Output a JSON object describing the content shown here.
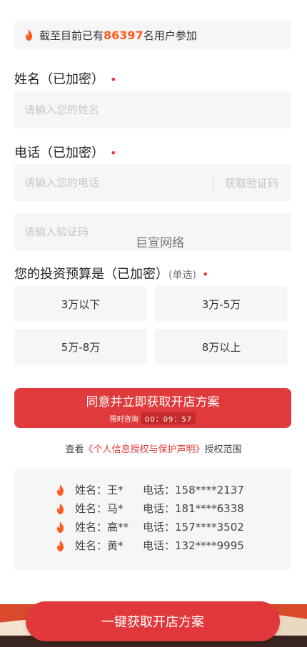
{
  "banner": {
    "prefix": "截至目前已有",
    "count": "86397",
    "suffix": "名用户参加"
  },
  "form": {
    "name_label": "姓名（已加密）",
    "name_placeholder": "请输入您的姓名",
    "phone_label": "电话（已加密）",
    "phone_placeholder": "请输入您的电话",
    "get_code": "获取验证码",
    "code_placeholder": "请输入验证码",
    "required_mark": "•",
    "budget_label": "您的投资预算是（已加密）",
    "budget_sub": "(单选)",
    "budget_options": [
      "3万以下",
      "3万-5万",
      "5万-8万",
      "8万以上"
    ]
  },
  "watermark": "巨宣网络",
  "submit": {
    "label": "同意并立即获取开店方案",
    "timer_label": "限时咨询",
    "timer_value": "00：09：57"
  },
  "privacy": {
    "prefix": "查看",
    "link": "《个人信息授权与保护声明》",
    "suffix": "授权范围"
  },
  "users": [
    {
      "name": "姓名：王*",
      "phone": "电话：158****2137"
    },
    {
      "name": "姓名：马*",
      "phone": "电话：181****6338"
    },
    {
      "name": "姓名：高**",
      "phone": "电话：157****3502"
    },
    {
      "name": "姓名：黄*",
      "phone": "电话：132****9995"
    }
  ],
  "bottom_button": "一键获取开店方案",
  "colors": {
    "accent": "#e13a3c",
    "count": "#ff5a1f",
    "flame": "#ff5a1f"
  },
  "icons": [
    "flame-icon"
  ]
}
